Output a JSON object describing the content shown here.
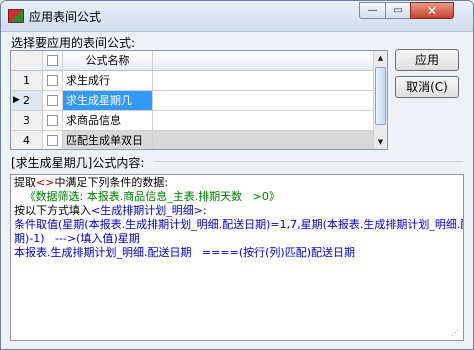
{
  "window": {
    "title": "应用表间公式",
    "min_glyph": "—",
    "max_glyph": "▭",
    "close_glyph": "✕"
  },
  "section": {
    "select_label": "选择要应用的表间公式:"
  },
  "table": {
    "header_name": "公式名称",
    "rows": [
      {
        "num": "1",
        "name": "求生成行",
        "marker": ""
      },
      {
        "num": "2",
        "name": "求生成星期几",
        "marker": "▶"
      },
      {
        "num": "3",
        "name": "求商品信息",
        "marker": ""
      },
      {
        "num": "4",
        "name": "匹配生成单双日",
        "marker": ""
      }
    ]
  },
  "buttons": {
    "apply": "应用",
    "cancel": "取消(C)"
  },
  "formula_section": {
    "label": "[求生成星期几]公式内容:"
  },
  "formula": {
    "line1": "提取",
    "line1b": "<>",
    "line1c": "中满足下列条件的数据:",
    "line2": "   《数据筛选: 本报表.商品信息_主表.排期天数   >0》",
    "line3": "按以下方式填入",
    "line3b": "<生成排期计划_明细>",
    "line3c": ":",
    "line4": "条件取值(星期(本报表.生成排期计划_明细.配送日期)=1,7,星期(本报表.生成排期计划_明细.配送日",
    "line5": "期)-1)   --->(填入值)星期",
    "line6": "本报表.生成排期计划_明细.配送日期   ====(按行(列)匹配)配送日期"
  }
}
